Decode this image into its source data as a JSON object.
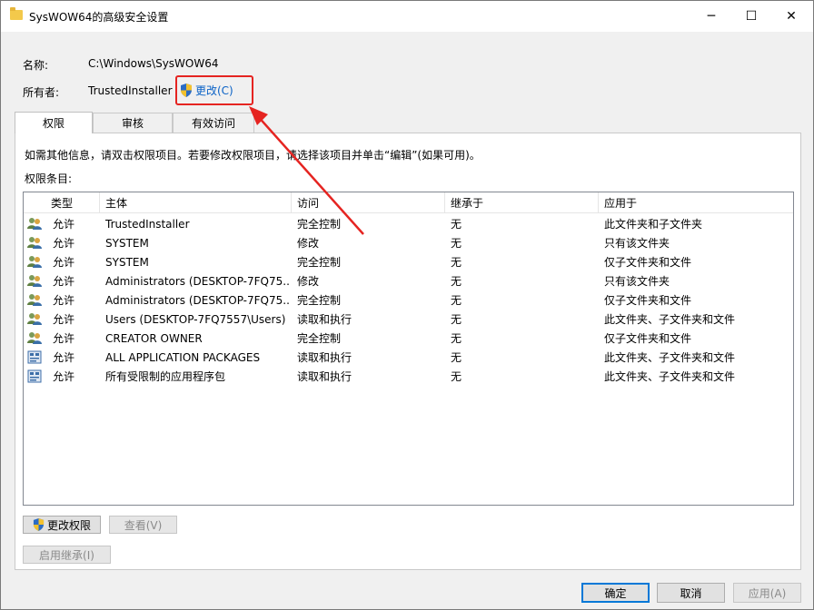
{
  "window": {
    "title": "SysWOW64的高级安全设置"
  },
  "titlebar": {
    "min_glyph": "─",
    "max_glyph": "☐",
    "close_glyph": "✕"
  },
  "header": {
    "name_label": "名称:",
    "name_value": "C:\\Windows\\SysWOW64",
    "owner_label": "所有者:",
    "owner_value": "TrustedInstaller",
    "change_link": "更改(C)"
  },
  "tabs": [
    {
      "label": "权限"
    },
    {
      "label": "审核"
    },
    {
      "label": "有效访问"
    }
  ],
  "permissions": {
    "info_text": "如需其他信息，请双击权限项目。若要修改权限项目，请选择该项目并单击“编辑”(如果可用)。",
    "entries_label": "权限条目:",
    "columns": [
      "类型",
      "主体",
      "访问",
      "继承于",
      "应用于"
    ],
    "rows": [
      {
        "icon": "user-group-icon",
        "type": "允许",
        "principal": "TrustedInstaller",
        "access": "完全控制",
        "inherited": "无",
        "applies": "此文件夹和子文件夹"
      },
      {
        "icon": "user-group-icon",
        "type": "允许",
        "principal": "SYSTEM",
        "access": "修改",
        "inherited": "无",
        "applies": "只有该文件夹"
      },
      {
        "icon": "user-group-icon",
        "type": "允许",
        "principal": "SYSTEM",
        "access": "完全控制",
        "inherited": "无",
        "applies": "仅子文件夹和文件"
      },
      {
        "icon": "user-group-icon",
        "type": "允许",
        "principal": "Administrators (DESKTOP-7FQ75...",
        "access": "修改",
        "inherited": "无",
        "applies": "只有该文件夹"
      },
      {
        "icon": "user-group-icon",
        "type": "允许",
        "principal": "Administrators (DESKTOP-7FQ75...",
        "access": "完全控制",
        "inherited": "无",
        "applies": "仅子文件夹和文件"
      },
      {
        "icon": "user-group-icon",
        "type": "允许",
        "principal": "Users (DESKTOP-7FQ7557\\Users)",
        "access": "读取和执行",
        "inherited": "无",
        "applies": "此文件夹、子文件夹和文件"
      },
      {
        "icon": "user-group-icon",
        "type": "允许",
        "principal": "CREATOR OWNER",
        "access": "完全控制",
        "inherited": "无",
        "applies": "仅子文件夹和文件"
      },
      {
        "icon": "app-package-icon",
        "type": "允许",
        "principal": "ALL APPLICATION PACKAGES",
        "access": "读取和执行",
        "inherited": "无",
        "applies": "此文件夹、子文件夹和文件"
      },
      {
        "icon": "app-package-icon",
        "type": "允许",
        "principal": "所有受限制的应用程序包",
        "access": "读取和执行",
        "inherited": "无",
        "applies": "此文件夹、子文件夹和文件"
      }
    ],
    "change_permissions_button": "更改权限",
    "view_button": "查看(V)",
    "enable_inheritance_button": "启用继承(I)"
  },
  "footer": {
    "ok": "确定",
    "cancel": "取消",
    "apply": "应用(A)"
  },
  "colors": {
    "link": "#0a62c6",
    "annotation_red": "#e52421",
    "primary_border": "#0078d7"
  }
}
